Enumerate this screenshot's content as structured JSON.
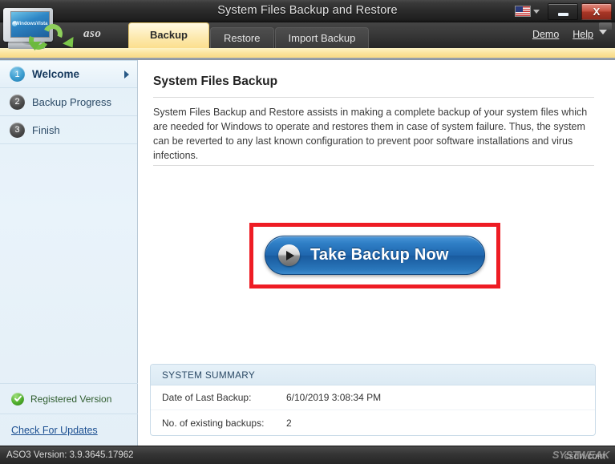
{
  "window": {
    "title": "System Files Backup and Restore",
    "flag_icon": "us-flag-icon",
    "language_caret": "chevron-down-icon",
    "minimize_label": "",
    "close_label": "X"
  },
  "brand": {
    "aso_mark": "aso",
    "logo_screen_text": "WindowsVista"
  },
  "tabs": [
    {
      "label": "Backup",
      "active": true
    },
    {
      "label": "Restore",
      "active": false
    },
    {
      "label": "Import Backup",
      "active": false
    }
  ],
  "top_links": {
    "demo": "Demo",
    "help": "Help"
  },
  "sidebar": {
    "items": [
      {
        "number": "1",
        "label": "Welcome",
        "selected": true
      },
      {
        "number": "2",
        "label": "Backup Progress",
        "selected": false
      },
      {
        "number": "3",
        "label": "Finish",
        "selected": false
      }
    ],
    "registered_label": "Registered Version",
    "updates_link": "Check For Updates"
  },
  "main": {
    "heading": "System Files Backup",
    "description": "System Files Backup and Restore assists in making a complete backup of your system files which are needed for Windows to operate and restores them in case of system failure. Thus, the system can be reverted to any last known configuration to prevent poor software installations and virus infections.",
    "primary_button": "Take Backup Now",
    "highlight_color": "#ee1c24",
    "button_color": "#1f66ae"
  },
  "summary": {
    "heading": "SYSTEM SUMMARY",
    "rows": [
      {
        "key": "Date of Last Backup:",
        "value": "6/10/2019 3:08:34 PM"
      },
      {
        "key": "No. of existing backups:",
        "value": "2"
      }
    ]
  },
  "status": {
    "version_text": "ASO3 Version: 3.9.3645.17962",
    "watermark": "SYSTWEAK",
    "watermark_overlay": "csdn.com"
  }
}
